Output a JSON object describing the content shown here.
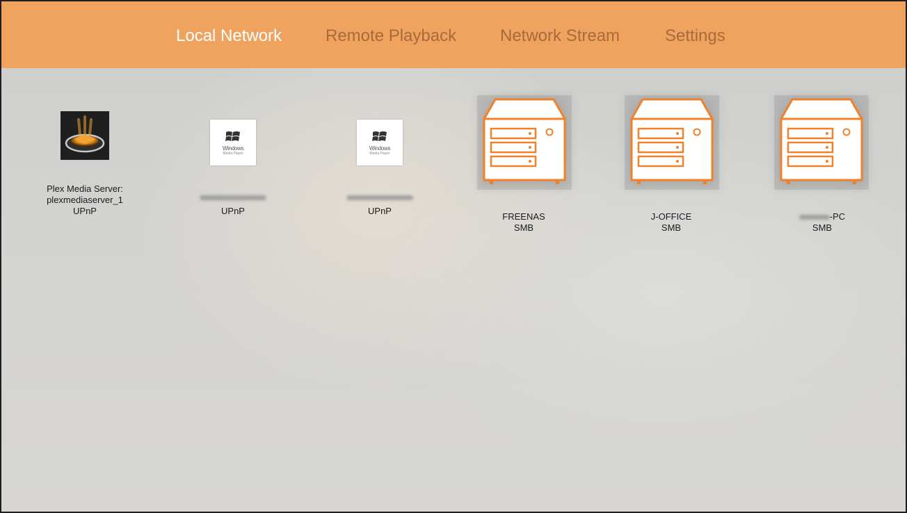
{
  "nav": {
    "tabs": [
      {
        "label": "Local Network",
        "active": true
      },
      {
        "label": "Remote Playback",
        "active": false
      },
      {
        "label": "Network Stream",
        "active": false
      },
      {
        "label": "Settings",
        "active": false
      }
    ]
  },
  "devices": [
    {
      "icon": "plex-server-icon",
      "name_lines": [
        "Plex Media Server:",
        "plexmediaserver_1"
      ],
      "protocol": "UPnP"
    },
    {
      "icon": "windows-media-player-icon",
      "name_obscured": true,
      "protocol": "UPnP",
      "icon_text": "Windows",
      "icon_subtext": "Media Player"
    },
    {
      "icon": "windows-media-player-icon",
      "name_obscured": true,
      "protocol": "UPnP",
      "icon_text": "Windows",
      "icon_subtext": "Media Player"
    },
    {
      "icon": "nas-server-icon",
      "name": "FREENAS",
      "protocol": "SMB"
    },
    {
      "icon": "nas-server-icon",
      "name": "J-OFFICE",
      "protocol": "SMB"
    },
    {
      "icon": "nas-server-icon",
      "name_suffix": "-PC",
      "name_obscured": true,
      "protocol": "SMB"
    }
  ],
  "colors": {
    "accent": "#f0a35e",
    "tab_inactive": "#a86a3a",
    "tab_active": "#ffffff",
    "nas_orange": "#f0812a"
  }
}
